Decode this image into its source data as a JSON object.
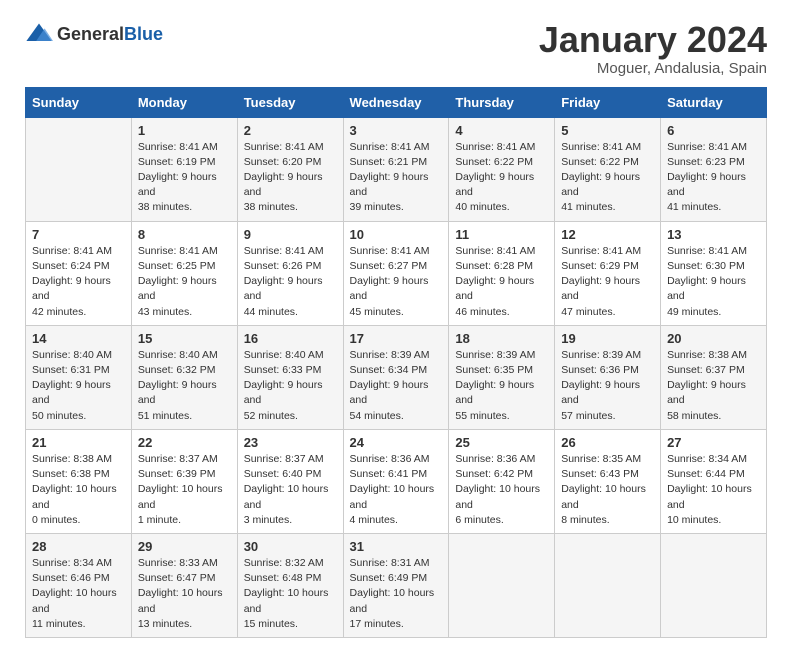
{
  "logo": {
    "text_general": "General",
    "text_blue": "Blue"
  },
  "title": "January 2024",
  "location": "Moguer, Andalusia, Spain",
  "days_of_week": [
    "Sunday",
    "Monday",
    "Tuesday",
    "Wednesday",
    "Thursday",
    "Friday",
    "Saturday"
  ],
  "weeks": [
    [
      {
        "day": "",
        "sunrise": "",
        "sunset": "",
        "daylight": ""
      },
      {
        "day": "1",
        "sunrise": "Sunrise: 8:41 AM",
        "sunset": "Sunset: 6:19 PM",
        "daylight": "Daylight: 9 hours and 38 minutes."
      },
      {
        "day": "2",
        "sunrise": "Sunrise: 8:41 AM",
        "sunset": "Sunset: 6:20 PM",
        "daylight": "Daylight: 9 hours and 38 minutes."
      },
      {
        "day": "3",
        "sunrise": "Sunrise: 8:41 AM",
        "sunset": "Sunset: 6:21 PM",
        "daylight": "Daylight: 9 hours and 39 minutes."
      },
      {
        "day": "4",
        "sunrise": "Sunrise: 8:41 AM",
        "sunset": "Sunset: 6:22 PM",
        "daylight": "Daylight: 9 hours and 40 minutes."
      },
      {
        "day": "5",
        "sunrise": "Sunrise: 8:41 AM",
        "sunset": "Sunset: 6:22 PM",
        "daylight": "Daylight: 9 hours and 41 minutes."
      },
      {
        "day": "6",
        "sunrise": "Sunrise: 8:41 AM",
        "sunset": "Sunset: 6:23 PM",
        "daylight": "Daylight: 9 hours and 41 minutes."
      }
    ],
    [
      {
        "day": "7",
        "sunrise": "Sunrise: 8:41 AM",
        "sunset": "Sunset: 6:24 PM",
        "daylight": "Daylight: 9 hours and 42 minutes."
      },
      {
        "day": "8",
        "sunrise": "Sunrise: 8:41 AM",
        "sunset": "Sunset: 6:25 PM",
        "daylight": "Daylight: 9 hours and 43 minutes."
      },
      {
        "day": "9",
        "sunrise": "Sunrise: 8:41 AM",
        "sunset": "Sunset: 6:26 PM",
        "daylight": "Daylight: 9 hours and 44 minutes."
      },
      {
        "day": "10",
        "sunrise": "Sunrise: 8:41 AM",
        "sunset": "Sunset: 6:27 PM",
        "daylight": "Daylight: 9 hours and 45 minutes."
      },
      {
        "day": "11",
        "sunrise": "Sunrise: 8:41 AM",
        "sunset": "Sunset: 6:28 PM",
        "daylight": "Daylight: 9 hours and 46 minutes."
      },
      {
        "day": "12",
        "sunrise": "Sunrise: 8:41 AM",
        "sunset": "Sunset: 6:29 PM",
        "daylight": "Daylight: 9 hours and 47 minutes."
      },
      {
        "day": "13",
        "sunrise": "Sunrise: 8:41 AM",
        "sunset": "Sunset: 6:30 PM",
        "daylight": "Daylight: 9 hours and 49 minutes."
      }
    ],
    [
      {
        "day": "14",
        "sunrise": "Sunrise: 8:40 AM",
        "sunset": "Sunset: 6:31 PM",
        "daylight": "Daylight: 9 hours and 50 minutes."
      },
      {
        "day": "15",
        "sunrise": "Sunrise: 8:40 AM",
        "sunset": "Sunset: 6:32 PM",
        "daylight": "Daylight: 9 hours and 51 minutes."
      },
      {
        "day": "16",
        "sunrise": "Sunrise: 8:40 AM",
        "sunset": "Sunset: 6:33 PM",
        "daylight": "Daylight: 9 hours and 52 minutes."
      },
      {
        "day": "17",
        "sunrise": "Sunrise: 8:39 AM",
        "sunset": "Sunset: 6:34 PM",
        "daylight": "Daylight: 9 hours and 54 minutes."
      },
      {
        "day": "18",
        "sunrise": "Sunrise: 8:39 AM",
        "sunset": "Sunset: 6:35 PM",
        "daylight": "Daylight: 9 hours and 55 minutes."
      },
      {
        "day": "19",
        "sunrise": "Sunrise: 8:39 AM",
        "sunset": "Sunset: 6:36 PM",
        "daylight": "Daylight: 9 hours and 57 minutes."
      },
      {
        "day": "20",
        "sunrise": "Sunrise: 8:38 AM",
        "sunset": "Sunset: 6:37 PM",
        "daylight": "Daylight: 9 hours and 58 minutes."
      }
    ],
    [
      {
        "day": "21",
        "sunrise": "Sunrise: 8:38 AM",
        "sunset": "Sunset: 6:38 PM",
        "daylight": "Daylight: 10 hours and 0 minutes."
      },
      {
        "day": "22",
        "sunrise": "Sunrise: 8:37 AM",
        "sunset": "Sunset: 6:39 PM",
        "daylight": "Daylight: 10 hours and 1 minute."
      },
      {
        "day": "23",
        "sunrise": "Sunrise: 8:37 AM",
        "sunset": "Sunset: 6:40 PM",
        "daylight": "Daylight: 10 hours and 3 minutes."
      },
      {
        "day": "24",
        "sunrise": "Sunrise: 8:36 AM",
        "sunset": "Sunset: 6:41 PM",
        "daylight": "Daylight: 10 hours and 4 minutes."
      },
      {
        "day": "25",
        "sunrise": "Sunrise: 8:36 AM",
        "sunset": "Sunset: 6:42 PM",
        "daylight": "Daylight: 10 hours and 6 minutes."
      },
      {
        "day": "26",
        "sunrise": "Sunrise: 8:35 AM",
        "sunset": "Sunset: 6:43 PM",
        "daylight": "Daylight: 10 hours and 8 minutes."
      },
      {
        "day": "27",
        "sunrise": "Sunrise: 8:34 AM",
        "sunset": "Sunset: 6:44 PM",
        "daylight": "Daylight: 10 hours and 10 minutes."
      }
    ],
    [
      {
        "day": "28",
        "sunrise": "Sunrise: 8:34 AM",
        "sunset": "Sunset: 6:46 PM",
        "daylight": "Daylight: 10 hours and 11 minutes."
      },
      {
        "day": "29",
        "sunrise": "Sunrise: 8:33 AM",
        "sunset": "Sunset: 6:47 PM",
        "daylight": "Daylight: 10 hours and 13 minutes."
      },
      {
        "day": "30",
        "sunrise": "Sunrise: 8:32 AM",
        "sunset": "Sunset: 6:48 PM",
        "daylight": "Daylight: 10 hours and 15 minutes."
      },
      {
        "day": "31",
        "sunrise": "Sunrise: 8:31 AM",
        "sunset": "Sunset: 6:49 PM",
        "daylight": "Daylight: 10 hours and 17 minutes."
      },
      {
        "day": "",
        "sunrise": "",
        "sunset": "",
        "daylight": ""
      },
      {
        "day": "",
        "sunrise": "",
        "sunset": "",
        "daylight": ""
      },
      {
        "day": "",
        "sunrise": "",
        "sunset": "",
        "daylight": ""
      }
    ]
  ]
}
